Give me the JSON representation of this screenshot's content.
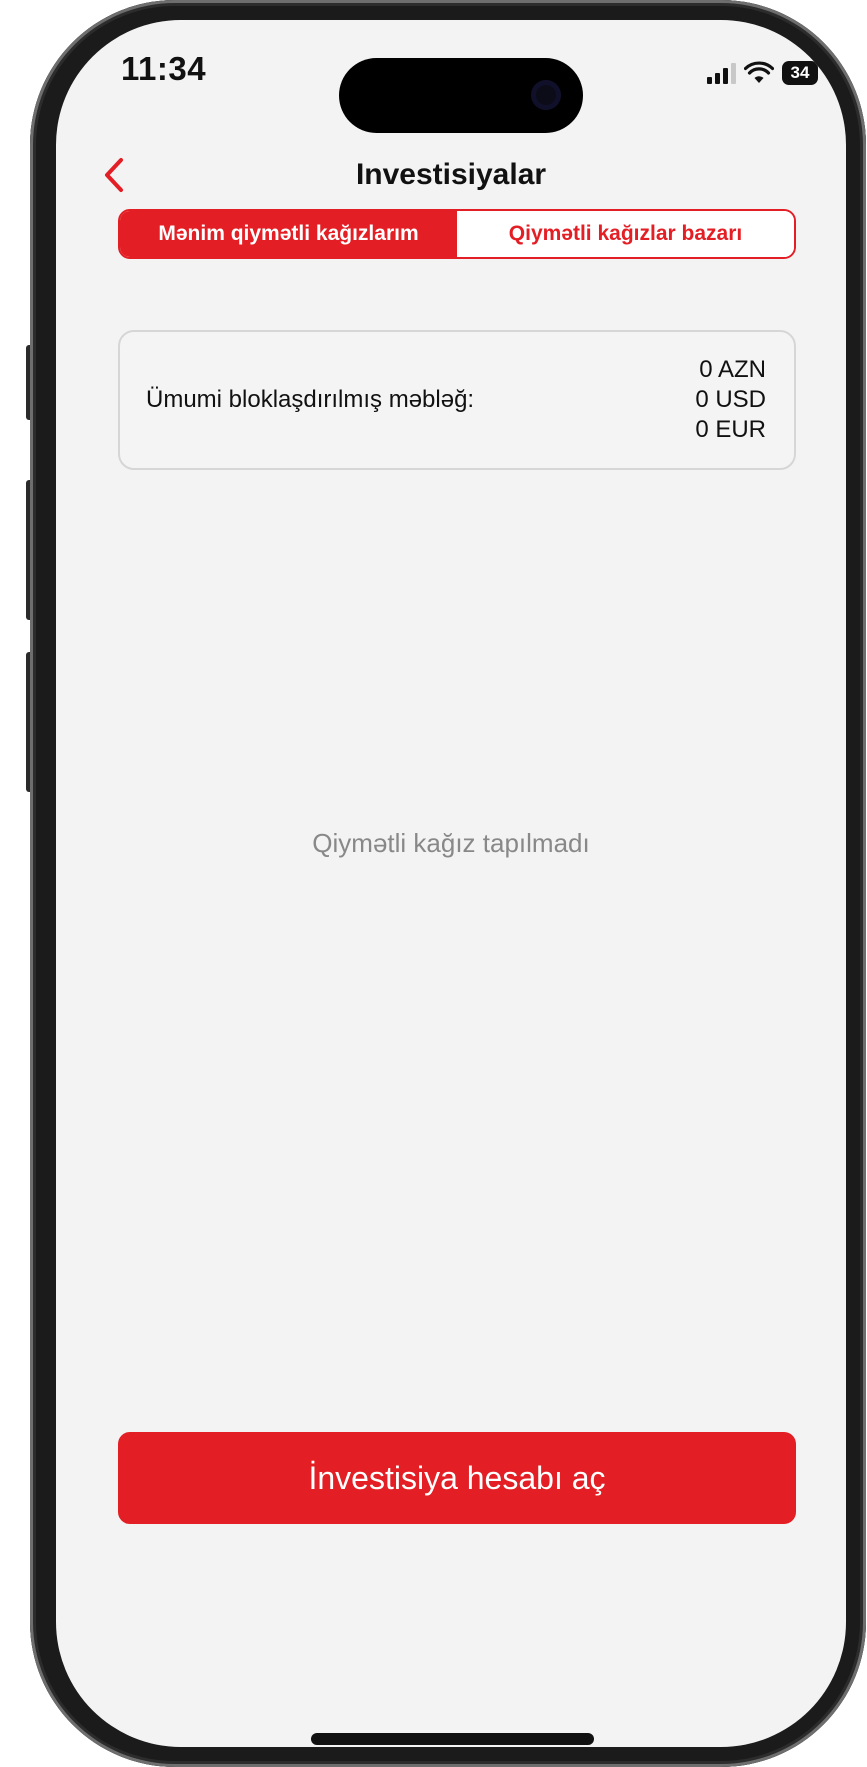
{
  "status_bar": {
    "time": "11:34",
    "battery": "34"
  },
  "header": {
    "title": "Investisiyalar"
  },
  "tabs": [
    {
      "label": "Mənim qiymətli kağızlarım",
      "active": true
    },
    {
      "label": "Qiymətli kağızlar bazarı",
      "active": false
    }
  ],
  "summary": {
    "label": "Ümumi bloklaşdırılmış məbləğ:",
    "values": [
      "0 AZN",
      "0 USD",
      "0 EUR"
    ]
  },
  "empty_state": {
    "message": "Qiymətli kağız tapılmadı"
  },
  "primary_action": {
    "label": "İnvestisiya hesabı aç"
  },
  "colors": {
    "accent": "#e31e24",
    "background": "#f3f3f3",
    "muted_text": "#888888"
  },
  "icons": [
    "back-chevron-icon",
    "signal-icon",
    "wifi-icon",
    "battery-icon"
  ]
}
